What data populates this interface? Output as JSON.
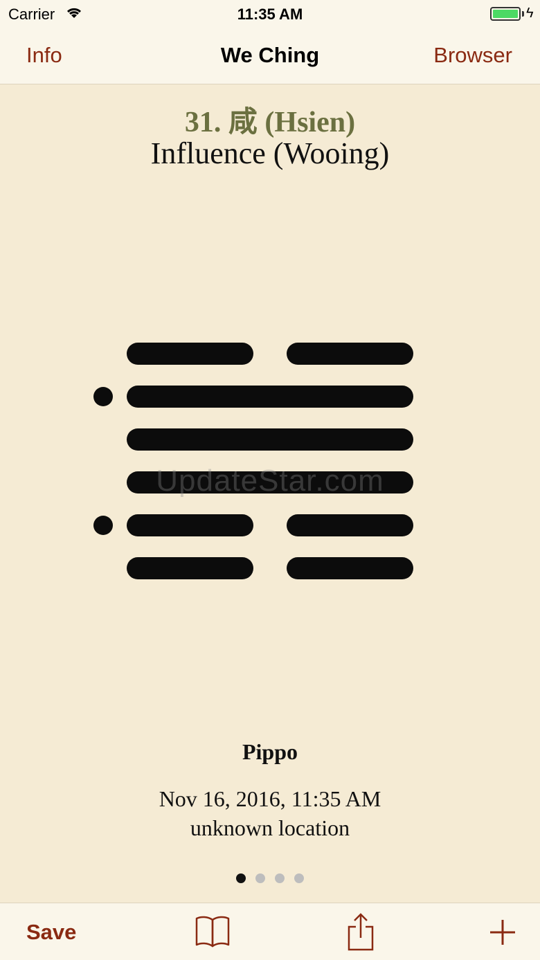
{
  "status_bar": {
    "carrier": "Carrier",
    "time": "11:35 AM",
    "icons": [
      "wifi-icon",
      "battery-icon",
      "charging-bolt-icon"
    ]
  },
  "nav": {
    "left_label": "Info",
    "title": "We Ching",
    "right_label": "Browser"
  },
  "hexagram": {
    "number_label": "31. 咸 (Hsien)",
    "name": "Influence (Wooing)",
    "lines_top_to_bottom": [
      "yin",
      "yang",
      "yang",
      "yang",
      "yin",
      "yin"
    ],
    "changing_lines_top_to_bottom": [
      false,
      true,
      false,
      false,
      true,
      false
    ]
  },
  "watermark": "UpdateStar.com",
  "reading": {
    "person": "Pippo",
    "datetime": "Nov 16, 2016, 11:35 AM",
    "location": "unknown location"
  },
  "pager": {
    "page_count": 4,
    "current_page": 1
  },
  "toolbar": {
    "save_label": "Save",
    "icons": [
      "book-icon",
      "share-icon",
      "plus-icon"
    ]
  },
  "colors": {
    "accent": "#8a2a12",
    "title_green": "#6b7040",
    "background": "#f5ebd4",
    "bar_background": "#faf6ea"
  }
}
